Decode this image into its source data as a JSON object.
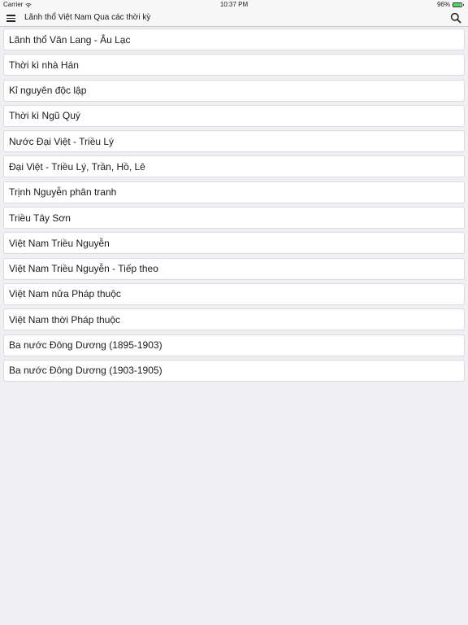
{
  "status_bar": {
    "carrier": "Carrier",
    "time": "10:37 PM",
    "battery": "96%",
    "battery_level": 0.96
  },
  "nav_bar": {
    "title": "Lãnh thổ Việt Nam Qua các thời kỳ",
    "menu_icon": "hamburger-menu-icon",
    "search_icon": "search-icon"
  },
  "list": {
    "items": [
      {
        "label": "Lãnh thổ Văn Lang - Âu Lạc"
      },
      {
        "label": "Thời kì nhà Hán"
      },
      {
        "label": "Kỉ nguyên độc lập"
      },
      {
        "label": "Thời kì Ngũ Quý"
      },
      {
        "label": "Nước Đại Việt - Triều Lý"
      },
      {
        "label": "Đại Việt - Triều Lý, Trần, Hồ, Lê"
      },
      {
        "label": "Trịnh Nguyễn phân tranh"
      },
      {
        "label": "Triều Tây Sơn"
      },
      {
        "label": "Việt Nam Triều Nguyễn"
      },
      {
        "label": "Việt Nam Triều Nguyễn - Tiếp theo"
      },
      {
        "label": "Việt Nam nửa Pháp thuộc"
      },
      {
        "label": "Việt Nam thời Pháp thuộc"
      },
      {
        "label": "Ba nước Đông Dương (1895-1903)"
      },
      {
        "label": "Ba nước Đông Dương (1903-1905)"
      }
    ]
  }
}
